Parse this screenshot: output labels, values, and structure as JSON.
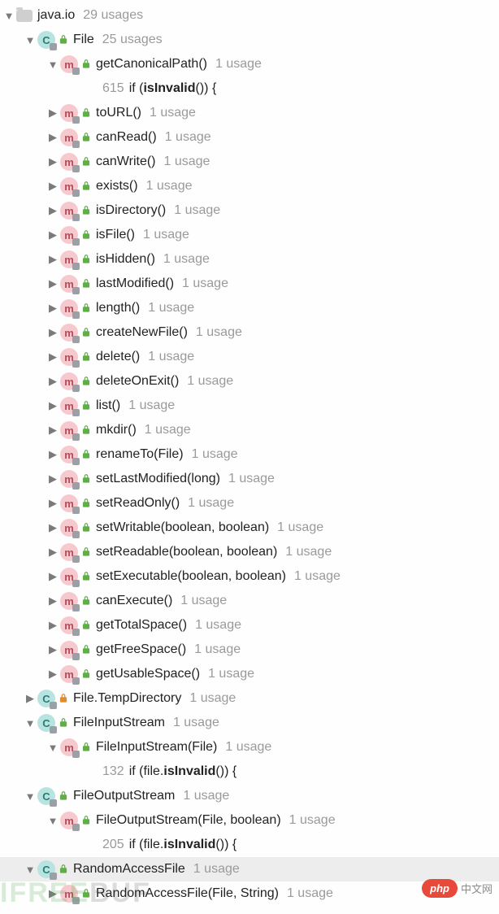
{
  "package": {
    "name": "java.io",
    "usages": "29 usages"
  },
  "fileClass": {
    "name": "File",
    "usages": "25 usages"
  },
  "methods": [
    {
      "arrow": "expanded",
      "name": "getCanonicalPath()",
      "usages": "1 usage",
      "code": {
        "line": "615",
        "prefix": "if (",
        "bold": "isInvalid",
        "suffix": "()) {"
      }
    },
    {
      "arrow": "collapsed",
      "name": "toURL()",
      "usages": "1 usage"
    },
    {
      "arrow": "collapsed",
      "name": "canRead()",
      "usages": "1 usage"
    },
    {
      "arrow": "collapsed",
      "name": "canWrite()",
      "usages": "1 usage"
    },
    {
      "arrow": "collapsed",
      "name": "exists()",
      "usages": "1 usage"
    },
    {
      "arrow": "collapsed",
      "name": "isDirectory()",
      "usages": "1 usage"
    },
    {
      "arrow": "collapsed",
      "name": "isFile()",
      "usages": "1 usage"
    },
    {
      "arrow": "collapsed",
      "name": "isHidden()",
      "usages": "1 usage"
    },
    {
      "arrow": "collapsed",
      "name": "lastModified()",
      "usages": "1 usage"
    },
    {
      "arrow": "collapsed",
      "name": "length()",
      "usages": "1 usage"
    },
    {
      "arrow": "collapsed",
      "name": "createNewFile()",
      "usages": "1 usage"
    },
    {
      "arrow": "collapsed",
      "name": "delete()",
      "usages": "1 usage"
    },
    {
      "arrow": "collapsed",
      "name": "deleteOnExit()",
      "usages": "1 usage"
    },
    {
      "arrow": "collapsed",
      "name": "list()",
      "usages": "1 usage"
    },
    {
      "arrow": "collapsed",
      "name": "mkdir()",
      "usages": "1 usage"
    },
    {
      "arrow": "collapsed",
      "name": "renameTo(File)",
      "usages": "1 usage"
    },
    {
      "arrow": "collapsed",
      "name": "setLastModified(long)",
      "usages": "1 usage"
    },
    {
      "arrow": "collapsed",
      "name": "setReadOnly()",
      "usages": "1 usage"
    },
    {
      "arrow": "collapsed",
      "name": "setWritable(boolean, boolean)",
      "usages": "1 usage"
    },
    {
      "arrow": "collapsed",
      "name": "setReadable(boolean, boolean)",
      "usages": "1 usage"
    },
    {
      "arrow": "collapsed",
      "name": "setExecutable(boolean, boolean)",
      "usages": "1 usage"
    },
    {
      "arrow": "collapsed",
      "name": "canExecute()",
      "usages": "1 usage"
    },
    {
      "arrow": "collapsed",
      "name": "getTotalSpace()",
      "usages": "1 usage"
    },
    {
      "arrow": "collapsed",
      "name": "getFreeSpace()",
      "usages": "1 usage"
    },
    {
      "arrow": "collapsed",
      "name": "getUsableSpace()",
      "usages": "1 usage"
    }
  ],
  "tempDir": {
    "name": "File.TempDirectory",
    "usages": "1 usage"
  },
  "fis": {
    "name": "FileInputStream",
    "usages": "1 usage",
    "ctor": {
      "name": "FileInputStream(File)",
      "usages": "1 usage",
      "code": {
        "line": "132",
        "prefix": "if (file.",
        "bold": "isInvalid",
        "suffix": "()) {"
      }
    }
  },
  "fos": {
    "name": "FileOutputStream",
    "usages": "1 usage",
    "ctor": {
      "name": "FileOutputStream(File, boolean)",
      "usages": "1 usage",
      "code": {
        "line": "205",
        "prefix": "if (file.",
        "bold": "isInvalid",
        "suffix": "()) {"
      }
    }
  },
  "raf": {
    "name": "RandomAccessFile",
    "usages": "1 usage",
    "ctor": {
      "name": "RandomAccessFile(File, String)",
      "usages": "1 usage"
    }
  },
  "watermark": {
    "text1": "IFREE",
    "text2": "BUF"
  },
  "badge": {
    "pill": "php",
    "cn": "中文网"
  }
}
